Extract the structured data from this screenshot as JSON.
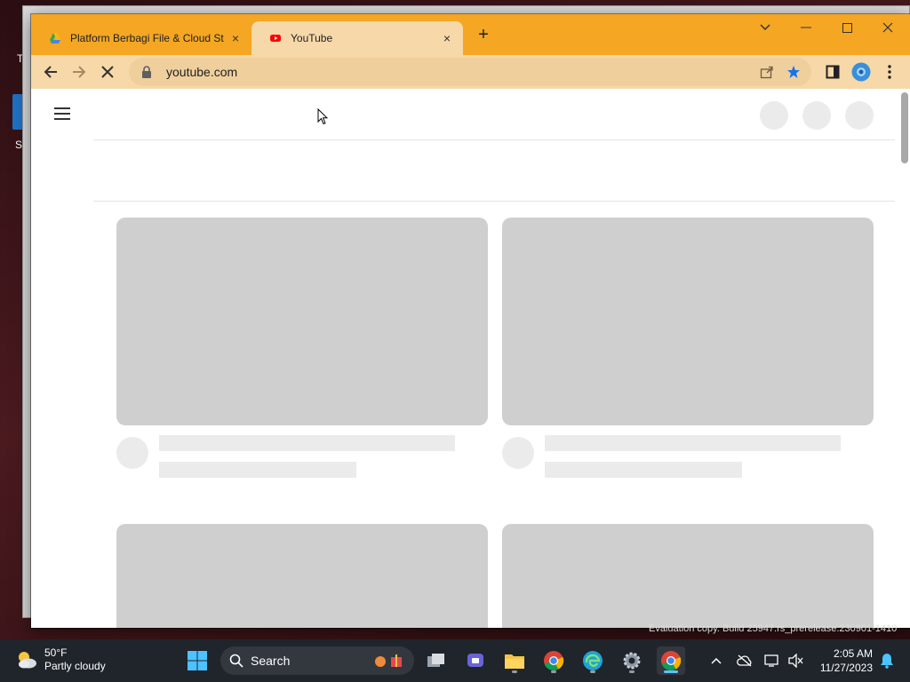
{
  "desktop": {
    "icon_label": "S",
    "edge_letter": "T"
  },
  "browser": {
    "tabs": [
      {
        "label": "Platform Berbagi File & Cloud St",
        "close": "×",
        "active": false
      },
      {
        "label": "YouTube",
        "close": "×",
        "active": true
      }
    ],
    "new_tab": "+",
    "address": {
      "url": "youtube.com"
    }
  },
  "watermark": "Evaluation copy. Build 25947.rs_prerelease.230901-1410",
  "taskbar": {
    "weather": {
      "temp": "50°F",
      "desc": "Partly cloudy"
    },
    "search": {
      "label": "Search"
    },
    "clock": {
      "time": "2:05 AM",
      "date": "11/27/2023"
    }
  },
  "colors": {
    "tabstrip": "#f5a623",
    "toolbar": "#f7d8a8",
    "placeholder": "#cfcfcf",
    "taskbar": "#20242b"
  }
}
